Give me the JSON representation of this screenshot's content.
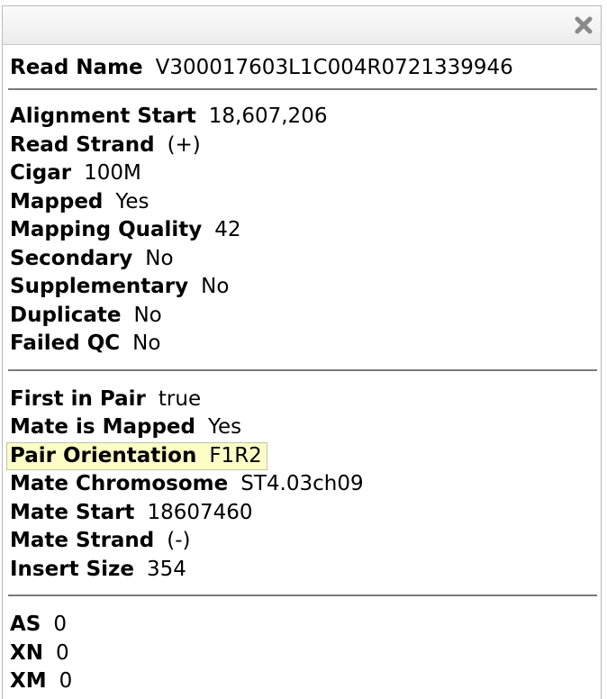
{
  "read_name": {
    "label": "Read Name",
    "value": "V300017603L1C004R0721339946"
  },
  "alignment": [
    {
      "label": "Alignment Start",
      "value": "18,607,206"
    },
    {
      "label": "Read Strand",
      "value": "(+)"
    },
    {
      "label": "Cigar",
      "value": "100M"
    },
    {
      "label": "Mapped",
      "value": "Yes"
    },
    {
      "label": "Mapping Quality",
      "value": "42"
    },
    {
      "label": "Secondary",
      "value": "No"
    },
    {
      "label": "Supplementary",
      "value": "No"
    },
    {
      "label": "Duplicate",
      "value": "No"
    },
    {
      "label": "Failed QC",
      "value": "No"
    }
  ],
  "pair": [
    {
      "label": "First in Pair",
      "value": "true"
    },
    {
      "label": "Mate is Mapped",
      "value": "Yes"
    },
    {
      "label": "Pair Orientation",
      "value": "F1R2"
    },
    {
      "label": "Mate Chromosome",
      "value": "ST4.03ch09"
    },
    {
      "label": "Mate Start",
      "value": "18607460"
    },
    {
      "label": "Mate Strand",
      "value": "(-)"
    },
    {
      "label": "Insert Size",
      "value": "354"
    }
  ],
  "tags": [
    {
      "label": "AS",
      "value": "0"
    },
    {
      "label": "XN",
      "value": "0"
    },
    {
      "label": "XM",
      "value": "0"
    }
  ],
  "icons": {
    "close": "close-icon"
  },
  "colors": {
    "highlight_bg": "#fdfdc6",
    "separator": "#7a7a7a"
  }
}
